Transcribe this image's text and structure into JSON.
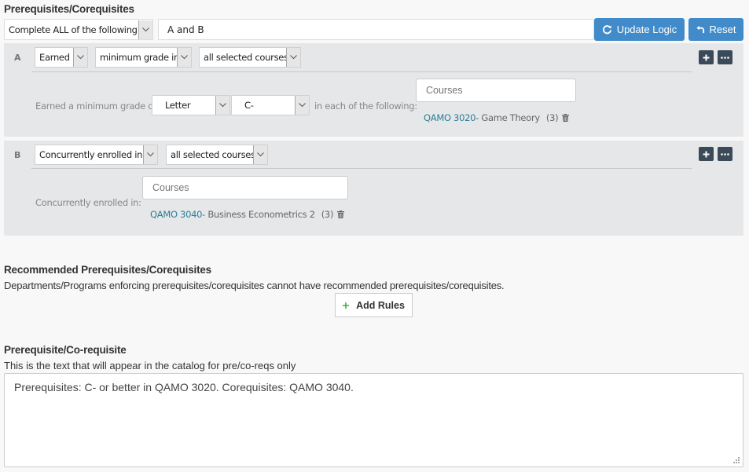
{
  "prereq": {
    "title": "Prerequisites/Corequisites",
    "logic_mode": "Complete ALL of the following",
    "logic_expression": "A and B",
    "update_logic_label": "Update Logic",
    "reset_label": "Reset",
    "rules": [
      {
        "letter": "A",
        "condition": "Earned",
        "qualifier": "minimum grade in",
        "scope": "all selected courses",
        "detail_label": "Earned a minimum grade of",
        "grade_type": "Letter",
        "grade_value": "C-",
        "suffix_label": "in each of the following:",
        "courses_placeholder": "Courses",
        "courses": [
          {
            "code": "QAMO 3020",
            "title": " - Game Theory",
            "credits": "(3)"
          }
        ]
      },
      {
        "letter": "B",
        "condition": "Concurrently enrolled in",
        "scope": "all selected courses",
        "detail_label": "Concurrently enrolled in:",
        "courses_placeholder": "Courses",
        "courses": [
          {
            "code": "QAMO 3040",
            "title": " - Business Econometrics 2",
            "credits": "(3)"
          }
        ]
      }
    ]
  },
  "recommended": {
    "title": "Recommended Prerequisites/Corequisites",
    "note": "Departments/Programs enforcing prerequisites/corequisites cannot have recommended prerequisites/corequisites.",
    "add_rules_label": "Add Rules"
  },
  "catalog": {
    "title": "Prerequisite/Co-requisite",
    "description": "This is the text that will appear in the catalog for pre/co-reqs only",
    "text": "Prerequisites: C- or better in QAMO 3020. Corequisites: QAMO 3040."
  },
  "colors": {
    "primary_button": "#428bca",
    "course_link": "#2a7f96",
    "dark_button": "#3a4a59",
    "add_icon": "#3cb043"
  }
}
